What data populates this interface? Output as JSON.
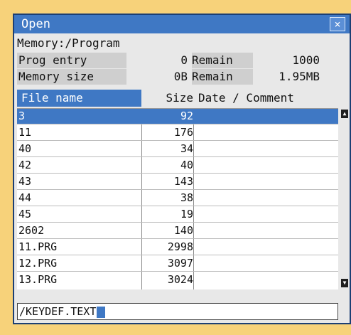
{
  "dialog": {
    "title": "Open",
    "close_label": "×"
  },
  "path": "Memory:/Program",
  "info": {
    "prog_entry_label": "Prog entry",
    "prog_entry_value": "0",
    "prog_remain_label": "Remain",
    "prog_remain_value": "1000",
    "memory_size_label": "Memory size",
    "memory_size_value": "0B",
    "memory_remain_label": "Remain",
    "memory_remain_value": "1.95MB"
  },
  "table": {
    "headers": {
      "name": "File name",
      "size": "Size",
      "date_comment": "Date / Comment"
    },
    "rows": [
      {
        "name": "3",
        "size": "92",
        "selected": true
      },
      {
        "name": "11",
        "size": "176"
      },
      {
        "name": "40",
        "size": "34"
      },
      {
        "name": "42",
        "size": "40"
      },
      {
        "name": "43",
        "size": "143"
      },
      {
        "name": "44",
        "size": "38"
      },
      {
        "name": "45",
        "size": "19"
      },
      {
        "name": "2602",
        "size": "140"
      },
      {
        "name": "11.PRG",
        "size": "2998"
      },
      {
        "name": "12.PRG",
        "size": "3097"
      },
      {
        "name": "13.PRG",
        "size": "3024"
      }
    ]
  },
  "input": {
    "value": "/KEYDEF.TEXT"
  },
  "colors": {
    "accent": "#3f78c4",
    "background": "#f7d27a"
  }
}
